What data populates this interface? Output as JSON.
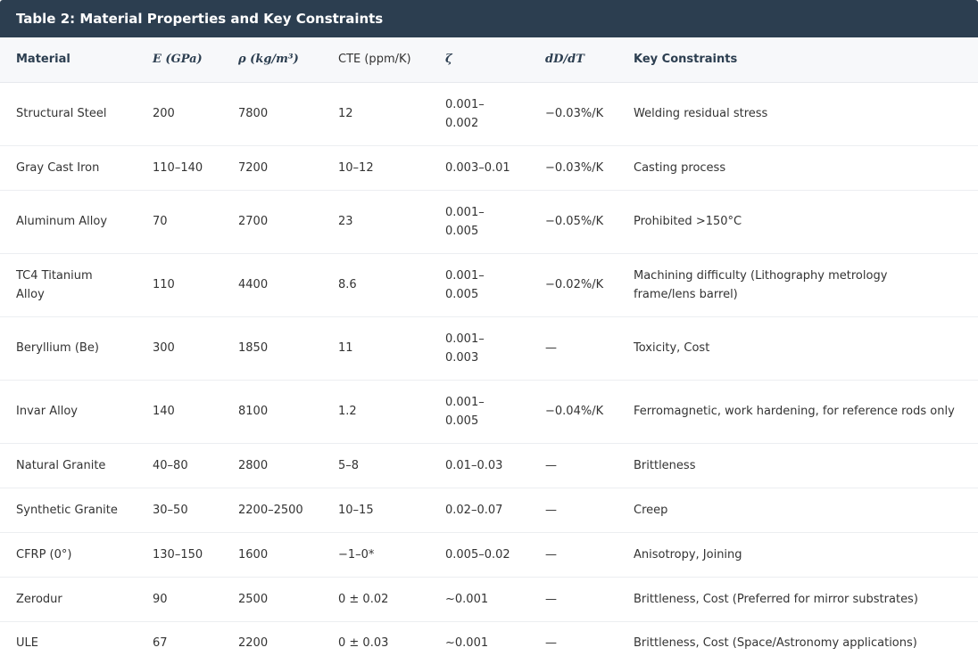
{
  "title": "Table 2: Material Properties and Key Constraints",
  "headers": {
    "material": "Material",
    "e": "E (GPa)",
    "rho": "ρ (kg/m³)",
    "cte": "CTE (ppm/K)",
    "zeta": "ζ",
    "dddt": "dD/dT",
    "constraints": "Key Constraints"
  },
  "rows": [
    {
      "material": "Structural Steel",
      "e": "200",
      "rho": "7800",
      "cte": "12",
      "zeta": "0.001–0.002",
      "dddt": "−0.03%/K",
      "constraints": "Welding residual stress"
    },
    {
      "material": "Gray Cast Iron",
      "e": "110–140",
      "rho": "7200",
      "cte": "10–12",
      "zeta": "0.003–0.01",
      "dddt": "−0.03%/K",
      "constraints": "Casting process"
    },
    {
      "material": "Aluminum Alloy",
      "e": "70",
      "rho": "2700",
      "cte": "23",
      "zeta": "0.001–0.005",
      "dddt": "−0.05%/K",
      "constraints": "Prohibited >150°C"
    },
    {
      "material": "TC4 Titanium Alloy",
      "e": "110",
      "rho": "4400",
      "cte": "8.6",
      "zeta": "0.001–0.005",
      "dddt": "−0.02%/K",
      "constraints": "Machining difficulty (Lithography metrology frame/lens barrel)"
    },
    {
      "material": "Beryllium (Be)",
      "e": "300",
      "rho": "1850",
      "cte": "11",
      "zeta": "0.001–0.003",
      "dddt": "—",
      "constraints": "Toxicity, Cost"
    },
    {
      "material": "Invar Alloy",
      "e": "140",
      "rho": "8100",
      "cte": "1.2",
      "zeta": "0.001–0.005",
      "dddt": "−0.04%/K",
      "constraints": "Ferromagnetic, work hardening, for reference rods only"
    },
    {
      "material": "Natural Granite",
      "e": "40–80",
      "rho": "2800",
      "cte": "5–8",
      "zeta": "0.01–0.03",
      "dddt": "—",
      "constraints": "Brittleness"
    },
    {
      "material": "Synthetic Granite",
      "e": "30–50",
      "rho": "2200–2500",
      "cte": "10–15",
      "zeta": "0.02–0.07",
      "dddt": "—",
      "constraints": "Creep"
    },
    {
      "material": "CFRP (0°)",
      "e": "130–150",
      "rho": "1600",
      "cte": "−1–0*",
      "zeta": "0.005–0.02",
      "dddt": "—",
      "constraints": "Anisotropy, Joining"
    },
    {
      "material": "Zerodur",
      "e": "90",
      "rho": "2500",
      "cte": "0 ± 0.02",
      "zeta": "~0.001",
      "dddt": "—",
      "constraints": "Brittleness, Cost (Preferred for mirror substrates)"
    },
    {
      "material": "ULE",
      "e": "67",
      "rho": "2200",
      "cte": "0 ± 0.03",
      "zeta": "~0.001",
      "dddt": "—",
      "constraints": "Brittleness, Cost (Space/Astronomy applications)"
    }
  ]
}
